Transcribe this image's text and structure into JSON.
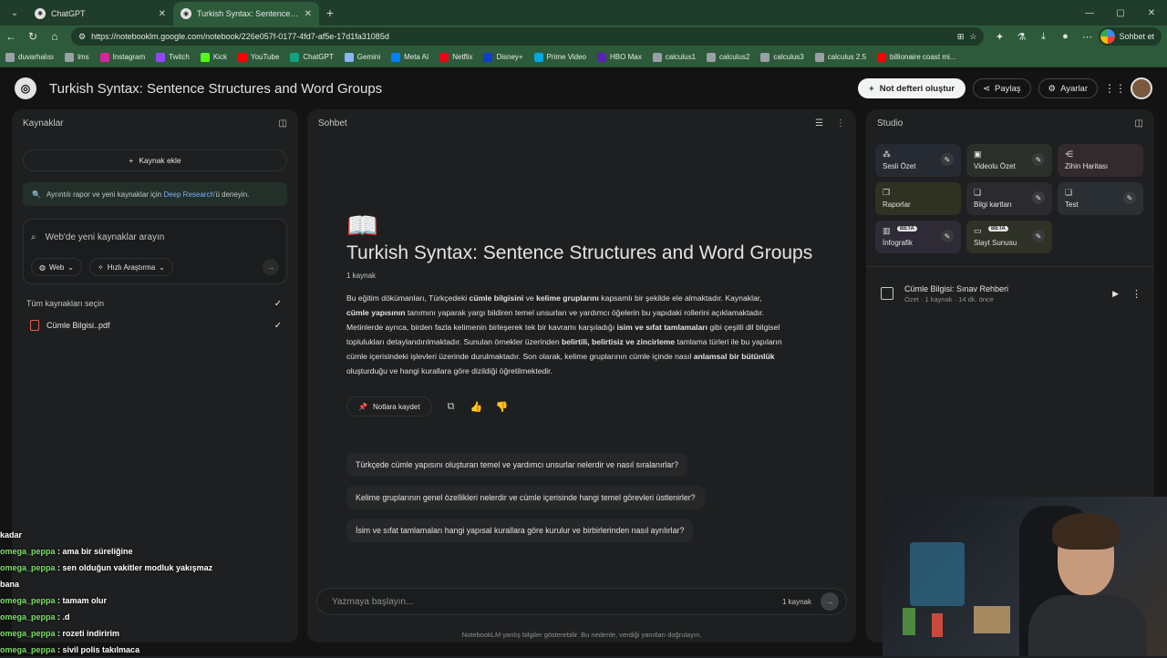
{
  "browser": {
    "tabs": [
      {
        "title": "ChatGPT",
        "active": false
      },
      {
        "title": "Turkish Syntax: Sentence Structure",
        "active": true
      }
    ],
    "url": "https://notebooklm.google.com/notebook/226e057f-0177-4fd7-af5e-17d1fa31085d",
    "profile_label": "Sohbet et",
    "bookmarks": [
      "duvarhalısı",
      "lms",
      "Instagram",
      "Twitch",
      "Kick",
      "YouTube",
      "ChatGPT",
      "Gemini",
      "Meta AI",
      "Netflix",
      "Disney+",
      "Prime Video",
      "HBO Max",
      "calculus1",
      "calculus2",
      "calculus3",
      "calculus 2.5",
      "billionaire coast mi..."
    ],
    "bookmark_colors": [
      "#9aa0a6",
      "#9aa0a6",
      "#d6249f",
      "#9146ff",
      "#53fc18",
      "#ff0000",
      "#10a37f",
      "#8ab4f8",
      "#0081fb",
      "#e50914",
      "#113ccf",
      "#00a8e1",
      "#5822b4",
      "#9aa0a6",
      "#9aa0a6",
      "#9aa0a6",
      "#9aa0a6",
      "#ff0000"
    ]
  },
  "header": {
    "title": "Turkish Syntax: Sentence Structures and Word Groups",
    "new_notebook": "Not defteri oluştur",
    "share": "Paylaş",
    "settings": "Ayarlar"
  },
  "sources": {
    "title": "Kaynaklar",
    "add_source": "Kaynak ekle",
    "banner_pre": "Ayrıntılı rapor ve yeni kaynaklar için ",
    "banner_link": "Deep Research",
    "banner_post": "'ü deneyin.",
    "search_placeholder": "Web'de yeni kaynaklar arayın",
    "chip_web": "Web",
    "chip_research": "Hızlı Araştırma",
    "select_all": "Tüm kaynakları seçin",
    "items": [
      {
        "name": "Cümle Bilgisi..pdf"
      }
    ]
  },
  "chat": {
    "title": "Sohbet",
    "notebook_title": "Turkish Syntax: Sentence Structures and Word Groups",
    "source_count": "1 kaynak",
    "summary_parts": [
      {
        "t": "Bu eğitim dökümanları, Türkçedeki ",
        "b": false
      },
      {
        "t": "cümle bilgisini",
        "b": true
      },
      {
        "t": " ve ",
        "b": false
      },
      {
        "t": "kelime gruplarını",
        "b": true
      },
      {
        "t": " kapsamlı bir şekilde ele almaktadır. Kaynaklar, ",
        "b": false
      },
      {
        "t": "cümle yapısının",
        "b": true
      },
      {
        "t": " tanımını yaparak yargı bildiren temel unsurları ve yardımcı öğelerin bu yapıdaki rollerini açıklamaktadır. Metinlerde ayrıca, birden fazla kelimenin birleşerek tek bir kavramı karşıladığı ",
        "b": false
      },
      {
        "t": "isim ve sıfat tamlamaları",
        "b": true
      },
      {
        "t": " gibi çeşitli dil bilgisel toplulukları detaylandırılmaktadır. Sunulan örnekler üzerinden ",
        "b": false
      },
      {
        "t": "belirtili, belirtisiz ve zincirleme",
        "b": true
      },
      {
        "t": " tamlama türleri ile bu yapıların cümle içerisindeki işlevleri üzerinde durulmaktadır. Son olarak, kelime gruplarının cümle içinde nasıl ",
        "b": false
      },
      {
        "t": "anlamsal bir bütünlük",
        "b": true
      },
      {
        "t": " oluşturduğu ve hangi kurallara göre dizildiği öğretilmektedir.",
        "b": false
      }
    ],
    "save_note": "Notlara kaydet",
    "suggestions": [
      "Türkçede cümle yapısını oluşturan temel ve yardımcı unsurlar nelerdir ve nasıl sıralanırlar?",
      "Kelime gruplarının genel özellikleri nelerdir ve cümle içerisinde hangi temel görevleri üstlenirler?",
      "İsim ve sıfat tamlamaları hangi yapısal kurallara göre kurulur ve birbirlerinden nasıl ayrılırlar?"
    ],
    "input_placeholder": "Yazmaya başlayın...",
    "input_source_count": "1 kaynak",
    "disclaimer": "NotebookLM yanlış bilgiler gösterebilir. Bu nedenle, verdiği yanıtları doğrulayın."
  },
  "studio": {
    "title": "Studio",
    "tiles": [
      {
        "label": "Sesli Özet",
        "icon": "audio-icon",
        "glyph": "⁂",
        "edit": true,
        "beta": false
      },
      {
        "label": "Videolu Özet",
        "icon": "video-icon",
        "glyph": "▣",
        "edit": true,
        "beta": false
      },
      {
        "label": "Zihin Haritası",
        "icon": "mindmap-icon",
        "glyph": "⋲",
        "edit": false,
        "beta": false
      },
      {
        "label": "Raporlar",
        "icon": "report-icon",
        "glyph": "❐",
        "edit": false,
        "beta": false
      },
      {
        "label": "Bilgi kartları",
        "icon": "flashcard-icon",
        "glyph": "❏",
        "edit": true,
        "beta": false
      },
      {
        "label": "Test",
        "icon": "quiz-icon",
        "glyph": "❏",
        "edit": true,
        "beta": false
      },
      {
        "label": "İnfografik",
        "icon": "infographic-icon",
        "glyph": "▥",
        "edit": true,
        "beta": true
      },
      {
        "label": "Slayt Sunusu",
        "icon": "slides-icon",
        "glyph": "▭",
        "edit": true,
        "beta": true
      }
    ],
    "beta_label": "BETA",
    "note": {
      "title": "Cümle Bilgisi: Sınav Rehberi",
      "meta": "Özet · 1 kaynak · 14 dk. önce"
    }
  },
  "stream_chat": [
    {
      "user": "",
      "msg": "kadar"
    },
    {
      "user": "omega_peppa",
      "msg": " : ama bir süreliğine"
    },
    {
      "user": "omega_peppa",
      "msg": " : sen olduğun vakitler modluk yakışmaz"
    },
    {
      "user": "",
      "msg": "bana"
    },
    {
      "user": "omega_peppa",
      "msg": " : tamam olur"
    },
    {
      "user": "omega_peppa",
      "msg": " : .d"
    },
    {
      "user": "omega_peppa",
      "msg": " : rozeti indiririm"
    },
    {
      "user": "omega_peppa",
      "msg": " : sivil polis takılmaca"
    }
  ]
}
